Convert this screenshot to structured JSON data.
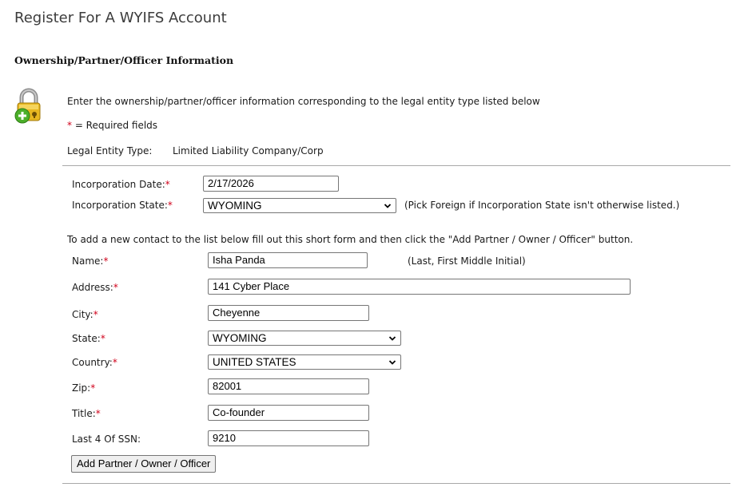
{
  "page": {
    "title": "Register For A WYIFS Account"
  },
  "section": {
    "title": "Ownership/Partner/Officer Information",
    "intro": "Enter the ownership/partner/officer information corresponding to the legal entity type listed below",
    "required_marker": "*",
    "required_text": " = Required fields",
    "legal_entity_label": "Legal Entity Type:",
    "legal_entity_value": "Limited Liability Company/Corp",
    "icon": "lock-add-icon"
  },
  "incorporation": {
    "date_label": "Incorporation Date:",
    "date_value": "2/17/2026",
    "state_label": "Incorporation State:",
    "state_value": "WYOMING",
    "state_hint": "(Pick Foreign if Incorporation State isn't otherwise listed.)"
  },
  "contact_form": {
    "instructions": "To add a new contact to the list below fill out this short form and then click the \"Add Partner / Owner / Officer\" button.",
    "name_label": "Name:",
    "name_value": "Isha Panda",
    "name_hint": "(Last, First Middle Initial)",
    "address_label": "Address:",
    "address_value": "141 Cyber Place",
    "city_label": "City:",
    "city_value": "Cheyenne",
    "state_label": "State:",
    "state_value": "WYOMING",
    "country_label": "Country:",
    "country_value": "UNITED STATES",
    "zip_label": "Zip:",
    "zip_value": "82001",
    "title_label": "Title:",
    "title_value": "Co-founder",
    "ssn_label": "Last 4 Of SSN:",
    "ssn_value": "9210",
    "add_button_label": "Add Partner / Owner / Officer"
  },
  "colors": {
    "required": "#d0021b",
    "divider": "#a8a8a8"
  }
}
